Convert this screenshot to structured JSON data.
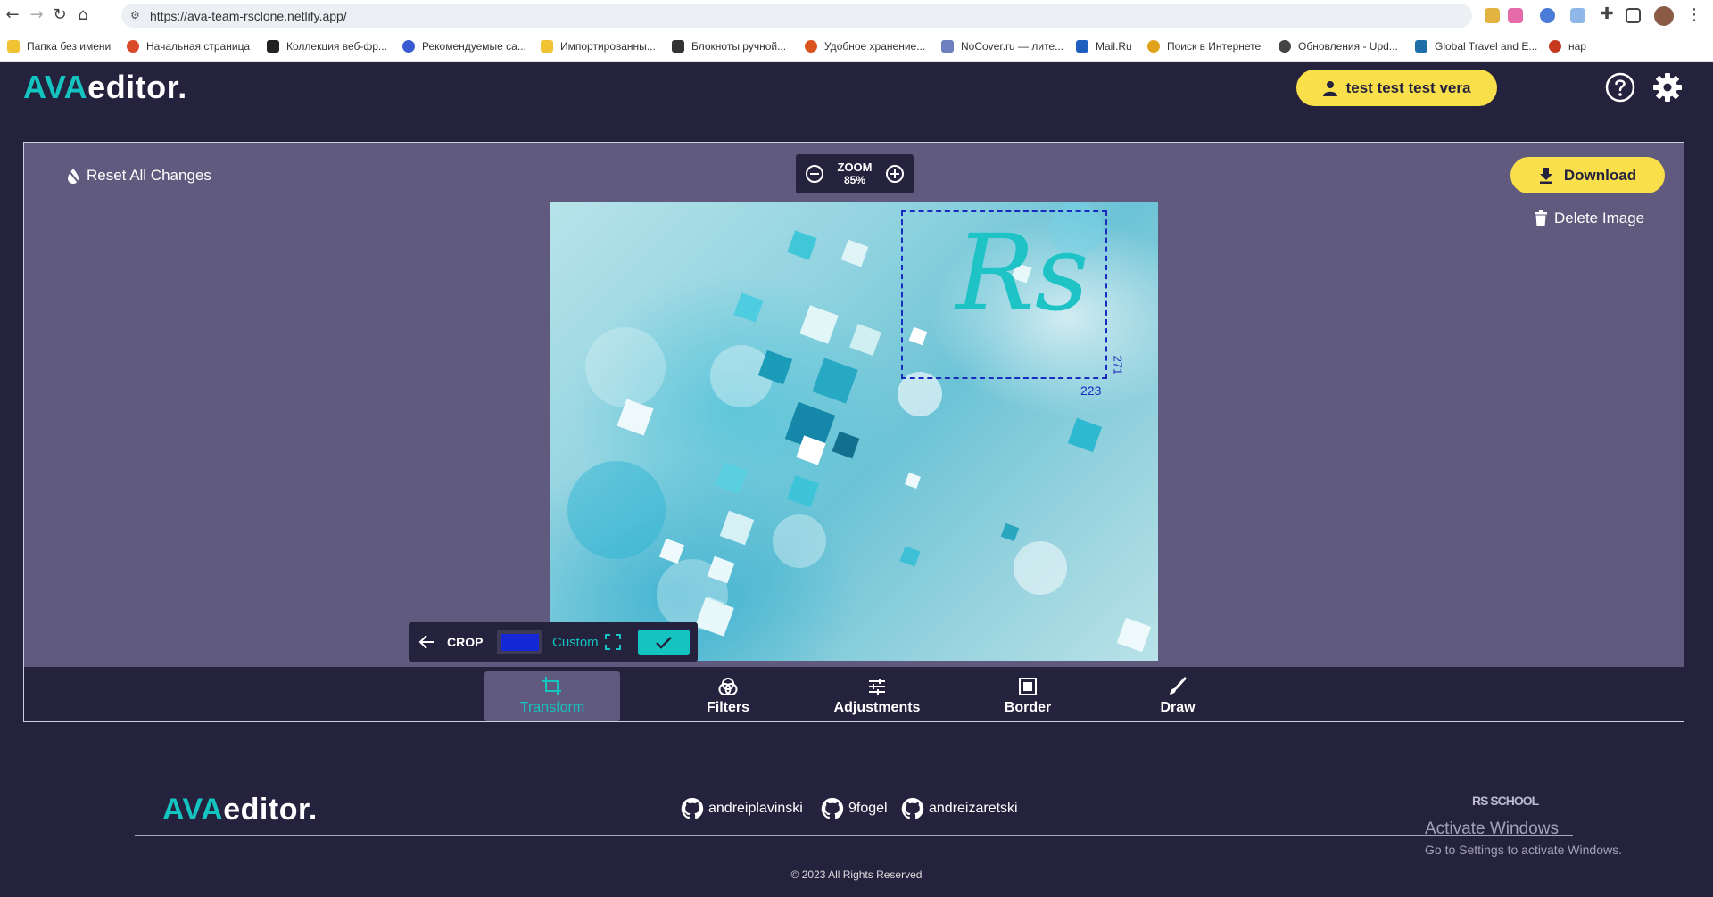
{
  "browser": {
    "url": "https://ava-team-rsclone.netlify.app/",
    "bookmarks": [
      "Папка без имени",
      "Начальная страница",
      "Коллекция веб-фр...",
      "Рекомендуемые са...",
      "Импортированны...",
      "Блокноты ручной...",
      "Удобное хранение...",
      "NoCover.ru — лите...",
      "Mail.Ru",
      "Поиск в Интернете",
      "Обновления - Upd...",
      "Global Travel and E...",
      "нар"
    ]
  },
  "header": {
    "logo_accent": "AVA",
    "logo_rest": "editor.",
    "user_name": "test test test vera"
  },
  "editor": {
    "reset_label": "Reset All Changes",
    "zoom_label": "ZOOM",
    "zoom_value": "85%",
    "download_label": "Download",
    "delete_label": "Delete Image",
    "drawing_text": "Rs",
    "crop_width": "223",
    "crop_height": "271",
    "crop": {
      "label": "CROP",
      "ratio_label": "Custom",
      "swatch_color": "#1428d8"
    }
  },
  "tabs": [
    {
      "label": "Transform",
      "icon": "crop-icon"
    },
    {
      "label": "Filters",
      "icon": "filters-icon"
    },
    {
      "label": "Adjustments",
      "icon": "sliders-icon"
    },
    {
      "label": "Border",
      "icon": "border-icon"
    },
    {
      "label": "Draw",
      "icon": "brush-icon"
    }
  ],
  "footer": {
    "logo_accent": "AVA",
    "logo_rest": "editor.",
    "github_users": [
      "andreiplavinski",
      "9fogel",
      "andreizaretski"
    ],
    "copyright": "© 2023 All Rights Reserved",
    "school_logo": "RS SCHOOL",
    "watermark_title": "Activate Windows",
    "watermark_subtitle": "Go to Settings to activate Windows."
  },
  "colors": {
    "accent": "#14c4c0",
    "button_yellow": "#f9e04a",
    "background": "#25223d",
    "editor_bg": "#5f5a7e"
  }
}
